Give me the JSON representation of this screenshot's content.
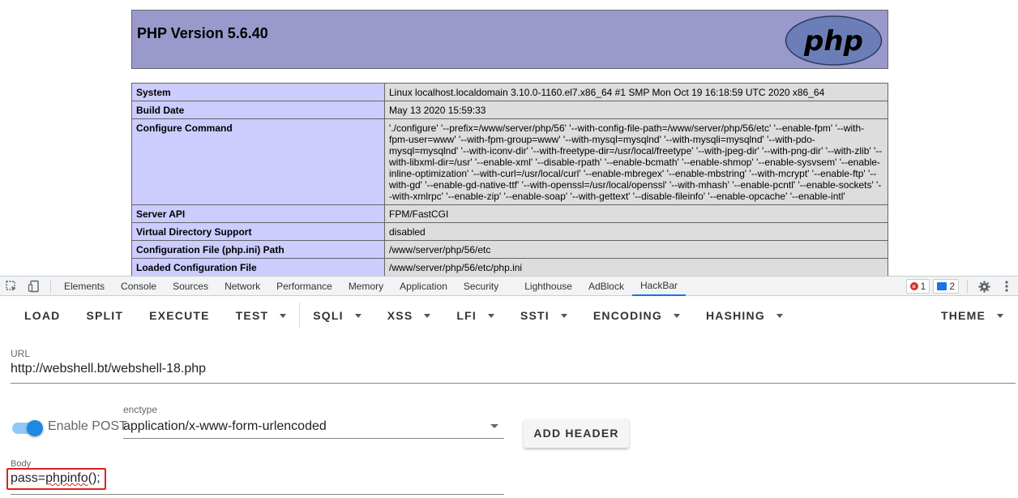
{
  "php": {
    "title": "PHP Version 5.6.40",
    "logo_text": "php",
    "rows": [
      {
        "key": "System",
        "value": "Linux localhost.localdomain 3.10.0-1160.el7.x86_64 #1 SMP Mon Oct 19 16:18:59 UTC 2020 x86_64"
      },
      {
        "key": "Build Date",
        "value": "May 13 2020 15:59:33"
      },
      {
        "key": "Configure Command",
        "value": "'./configure' '--prefix=/www/server/php/56' '--with-config-file-path=/www/server/php/56/etc' '--enable-fpm' '--with-fpm-user=www' '--with-fpm-group=www' '--with-mysql=mysqlnd' '--with-mysqli=mysqlnd' '--with-pdo-mysql=mysqlnd' '--with-iconv-dir' '--with-freetype-dir=/usr/local/freetype' '--with-jpeg-dir' '--with-png-dir' '--with-zlib' '--with-libxml-dir=/usr' '--enable-xml' '--disable-rpath' '--enable-bcmath' '--enable-shmop' '--enable-sysvsem' '--enable-inline-optimization' '--with-curl=/usr/local/curl' '--enable-mbregex' '--enable-mbstring' '--with-mcrypt' '--enable-ftp' '--with-gd' '--enable-gd-native-ttf' '--with-openssl=/usr/local/openssl' '--with-mhash' '--enable-pcntl' '--enable-sockets' '--with-xmlrpc' '--enable-zip' '--enable-soap' '--with-gettext' '--disable-fileinfo' '--enable-opcache' '--enable-intl'"
      },
      {
        "key": "Server API",
        "value": "FPM/FastCGI"
      },
      {
        "key": "Virtual Directory Support",
        "value": "disabled"
      },
      {
        "key": "Configuration File (php.ini) Path",
        "value": "/www/server/php/56/etc"
      },
      {
        "key": "Loaded Configuration File",
        "value": "/www/server/php/56/etc/php.ini"
      }
    ]
  },
  "devtools": {
    "tabs": [
      "Elements",
      "Console",
      "Sources",
      "Network",
      "Performance",
      "Memory",
      "Application",
      "Security",
      "Lighthouse",
      "AdBlock",
      "HackBar"
    ],
    "active_tab": "HackBar",
    "error_count": "1",
    "message_count": "2",
    "icons": [
      "inspect-icon",
      "device-toggle-icon",
      "gear-icon",
      "more-vert-icon"
    ]
  },
  "hackbar": {
    "toolbar": {
      "load": "LOAD",
      "split": "SPLIT",
      "execute": "EXECUTE",
      "test": "TEST",
      "sqli": "SQLI",
      "xss": "XSS",
      "lfi": "LFI",
      "ssti": "SSTI",
      "encoding": "ENCODING",
      "hashing": "HASHING",
      "theme": "THEME"
    },
    "url_label": "URL",
    "url_value": "http://webshell.bt/webshell-18.php",
    "enable_post_label": "Enable POST",
    "enable_post_checked": true,
    "enctype_label": "enctype",
    "enctype_value": "application/x-www-form-urlencoded",
    "add_header_label": "ADD HEADER",
    "body_label": "Body",
    "body_value_prefix": "pass=",
    "body_value_word": "phpinfo",
    "body_value_suffix": "();",
    "accent_color": "#1e88e5",
    "highlight_color": "#e02020"
  }
}
